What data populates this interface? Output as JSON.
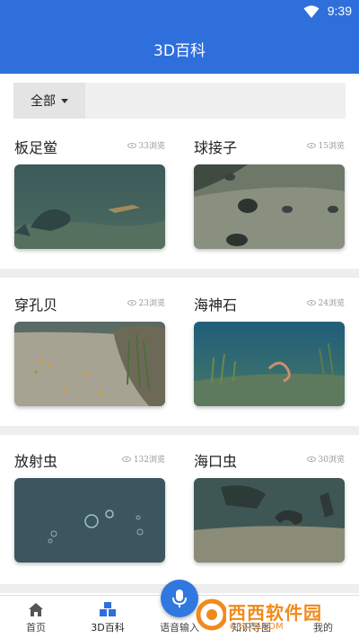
{
  "status": {
    "time": "9:39",
    "icons": [
      "wifi-icon"
    ]
  },
  "appbar": {
    "title": "3D百科"
  },
  "filter": {
    "selected": "全部"
  },
  "items": [
    {
      "name": "板足鲎",
      "views": "33浏览",
      "scene": "murky"
    },
    {
      "name": "球接子",
      "views": "15浏览",
      "scene": "sand-rocks"
    },
    {
      "name": "穿孔贝",
      "views": "23浏览",
      "scene": "sand-shells"
    },
    {
      "name": "海神石",
      "views": "24浏览",
      "scene": "reef"
    },
    {
      "name": "放射虫",
      "views": "132浏览",
      "scene": "bubbles"
    },
    {
      "name": "海口虫",
      "views": "30浏览",
      "scene": "dark-rocks"
    }
  ],
  "tabs": [
    {
      "label": "首页",
      "icon": "home-icon"
    },
    {
      "label": "3D百科",
      "icon": "cubes-icon",
      "active": true
    },
    {
      "label": "语音输入",
      "icon": "mic-icon"
    },
    {
      "label": "知识导图",
      "icon": "map-icon"
    },
    {
      "label": "我的",
      "icon": "user-icon"
    }
  ],
  "watermark": {
    "main": "西西软件园",
    "sub": "CR173.COM"
  },
  "colors": {
    "primary": "#2f6fdb",
    "mic": "#2f78e0",
    "watermark": "#f08a1c"
  }
}
